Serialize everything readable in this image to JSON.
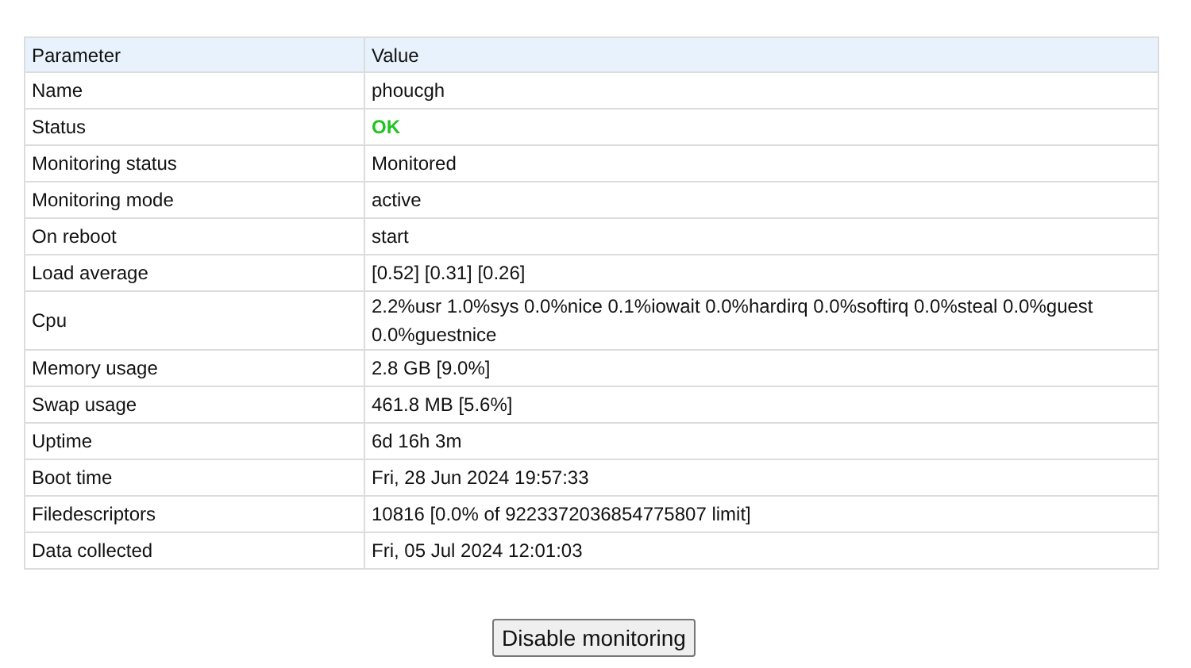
{
  "table": {
    "columns": [
      "Parameter",
      "Value"
    ],
    "rows": [
      {
        "kind": "text",
        "parameter": "Name",
        "value": "phoucgh"
      },
      {
        "kind": "status",
        "parameter": "Status",
        "value": "OK"
      },
      {
        "kind": "text",
        "parameter": "Monitoring status",
        "value": "Monitored"
      },
      {
        "kind": "text",
        "parameter": "Monitoring mode",
        "value": "active"
      },
      {
        "kind": "text",
        "parameter": "On reboot",
        "value": "start"
      },
      {
        "kind": "text",
        "parameter": "Load average",
        "value": "[0.52] [0.31] [0.26]"
      },
      {
        "kind": "text",
        "parameter": "Cpu",
        "value": "2.2%usr 1.0%sys 0.0%nice 0.1%iowait 0.0%hardirq 0.0%softirq 0.0%steal 0.0%guest 0.0%guestnice"
      },
      {
        "kind": "text",
        "parameter": "Memory usage",
        "value": "2.8 GB [9.0%]"
      },
      {
        "kind": "text",
        "parameter": "Swap usage",
        "value": "461.8 MB [5.6%]"
      },
      {
        "kind": "text",
        "parameter": "Uptime",
        "value": "6d 16h 3m"
      },
      {
        "kind": "text",
        "parameter": "Boot time",
        "value": "Fri, 28 Jun 2024 19:57:33"
      },
      {
        "kind": "text",
        "parameter": "Filedescriptors",
        "value": "10816 [0.0% of 9223372036854775807 limit]"
      },
      {
        "kind": "text",
        "parameter": "Data collected",
        "value": "Fri, 05 Jul 2024 12:01:03"
      }
    ]
  },
  "button": "Disable monitoring"
}
